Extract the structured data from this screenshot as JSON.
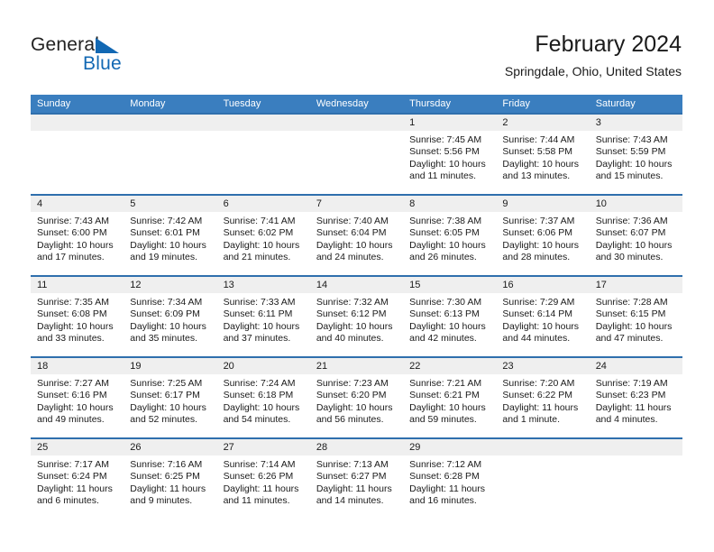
{
  "brand": {
    "name_part1": "General",
    "name_part2": "Blue",
    "flag_icon": "blue-triangle-flag-icon",
    "accent_color": "#1268b3"
  },
  "header": {
    "title": "February 2024",
    "subtitle": "Springdale, Ohio, United States"
  },
  "theme": {
    "header_blue": "#3a7ebf",
    "row_divider_blue": "#2f6fad",
    "day_band_gray": "#efefef"
  },
  "weekdays": [
    "Sunday",
    "Monday",
    "Tuesday",
    "Wednesday",
    "Thursday",
    "Friday",
    "Saturday"
  ],
  "weeks": [
    [
      {
        "day": "",
        "sunrise": "",
        "sunset": "",
        "daylight1": "",
        "daylight2": ""
      },
      {
        "day": "",
        "sunrise": "",
        "sunset": "",
        "daylight1": "",
        "daylight2": ""
      },
      {
        "day": "",
        "sunrise": "",
        "sunset": "",
        "daylight1": "",
        "daylight2": ""
      },
      {
        "day": "",
        "sunrise": "",
        "sunset": "",
        "daylight1": "",
        "daylight2": ""
      },
      {
        "day": "1",
        "sunrise": "Sunrise: 7:45 AM",
        "sunset": "Sunset: 5:56 PM",
        "daylight1": "Daylight: 10 hours",
        "daylight2": "and 11 minutes."
      },
      {
        "day": "2",
        "sunrise": "Sunrise: 7:44 AM",
        "sunset": "Sunset: 5:58 PM",
        "daylight1": "Daylight: 10 hours",
        "daylight2": "and 13 minutes."
      },
      {
        "day": "3",
        "sunrise": "Sunrise: 7:43 AM",
        "sunset": "Sunset: 5:59 PM",
        "daylight1": "Daylight: 10 hours",
        "daylight2": "and 15 minutes."
      }
    ],
    [
      {
        "day": "4",
        "sunrise": "Sunrise: 7:43 AM",
        "sunset": "Sunset: 6:00 PM",
        "daylight1": "Daylight: 10 hours",
        "daylight2": "and 17 minutes."
      },
      {
        "day": "5",
        "sunrise": "Sunrise: 7:42 AM",
        "sunset": "Sunset: 6:01 PM",
        "daylight1": "Daylight: 10 hours",
        "daylight2": "and 19 minutes."
      },
      {
        "day": "6",
        "sunrise": "Sunrise: 7:41 AM",
        "sunset": "Sunset: 6:02 PM",
        "daylight1": "Daylight: 10 hours",
        "daylight2": "and 21 minutes."
      },
      {
        "day": "7",
        "sunrise": "Sunrise: 7:40 AM",
        "sunset": "Sunset: 6:04 PM",
        "daylight1": "Daylight: 10 hours",
        "daylight2": "and 24 minutes."
      },
      {
        "day": "8",
        "sunrise": "Sunrise: 7:38 AM",
        "sunset": "Sunset: 6:05 PM",
        "daylight1": "Daylight: 10 hours",
        "daylight2": "and 26 minutes."
      },
      {
        "day": "9",
        "sunrise": "Sunrise: 7:37 AM",
        "sunset": "Sunset: 6:06 PM",
        "daylight1": "Daylight: 10 hours",
        "daylight2": "and 28 minutes."
      },
      {
        "day": "10",
        "sunrise": "Sunrise: 7:36 AM",
        "sunset": "Sunset: 6:07 PM",
        "daylight1": "Daylight: 10 hours",
        "daylight2": "and 30 minutes."
      }
    ],
    [
      {
        "day": "11",
        "sunrise": "Sunrise: 7:35 AM",
        "sunset": "Sunset: 6:08 PM",
        "daylight1": "Daylight: 10 hours",
        "daylight2": "and 33 minutes."
      },
      {
        "day": "12",
        "sunrise": "Sunrise: 7:34 AM",
        "sunset": "Sunset: 6:09 PM",
        "daylight1": "Daylight: 10 hours",
        "daylight2": "and 35 minutes."
      },
      {
        "day": "13",
        "sunrise": "Sunrise: 7:33 AM",
        "sunset": "Sunset: 6:11 PM",
        "daylight1": "Daylight: 10 hours",
        "daylight2": "and 37 minutes."
      },
      {
        "day": "14",
        "sunrise": "Sunrise: 7:32 AM",
        "sunset": "Sunset: 6:12 PM",
        "daylight1": "Daylight: 10 hours",
        "daylight2": "and 40 minutes."
      },
      {
        "day": "15",
        "sunrise": "Sunrise: 7:30 AM",
        "sunset": "Sunset: 6:13 PM",
        "daylight1": "Daylight: 10 hours",
        "daylight2": "and 42 minutes."
      },
      {
        "day": "16",
        "sunrise": "Sunrise: 7:29 AM",
        "sunset": "Sunset: 6:14 PM",
        "daylight1": "Daylight: 10 hours",
        "daylight2": "and 44 minutes."
      },
      {
        "day": "17",
        "sunrise": "Sunrise: 7:28 AM",
        "sunset": "Sunset: 6:15 PM",
        "daylight1": "Daylight: 10 hours",
        "daylight2": "and 47 minutes."
      }
    ],
    [
      {
        "day": "18",
        "sunrise": "Sunrise: 7:27 AM",
        "sunset": "Sunset: 6:16 PM",
        "daylight1": "Daylight: 10 hours",
        "daylight2": "and 49 minutes."
      },
      {
        "day": "19",
        "sunrise": "Sunrise: 7:25 AM",
        "sunset": "Sunset: 6:17 PM",
        "daylight1": "Daylight: 10 hours",
        "daylight2": "and 52 minutes."
      },
      {
        "day": "20",
        "sunrise": "Sunrise: 7:24 AM",
        "sunset": "Sunset: 6:18 PM",
        "daylight1": "Daylight: 10 hours",
        "daylight2": "and 54 minutes."
      },
      {
        "day": "21",
        "sunrise": "Sunrise: 7:23 AM",
        "sunset": "Sunset: 6:20 PM",
        "daylight1": "Daylight: 10 hours",
        "daylight2": "and 56 minutes."
      },
      {
        "day": "22",
        "sunrise": "Sunrise: 7:21 AM",
        "sunset": "Sunset: 6:21 PM",
        "daylight1": "Daylight: 10 hours",
        "daylight2": "and 59 minutes."
      },
      {
        "day": "23",
        "sunrise": "Sunrise: 7:20 AM",
        "sunset": "Sunset: 6:22 PM",
        "daylight1": "Daylight: 11 hours",
        "daylight2": "and 1 minute."
      },
      {
        "day": "24",
        "sunrise": "Sunrise: 7:19 AM",
        "sunset": "Sunset: 6:23 PM",
        "daylight1": "Daylight: 11 hours",
        "daylight2": "and 4 minutes."
      }
    ],
    [
      {
        "day": "25",
        "sunrise": "Sunrise: 7:17 AM",
        "sunset": "Sunset: 6:24 PM",
        "daylight1": "Daylight: 11 hours",
        "daylight2": "and 6 minutes."
      },
      {
        "day": "26",
        "sunrise": "Sunrise: 7:16 AM",
        "sunset": "Sunset: 6:25 PM",
        "daylight1": "Daylight: 11 hours",
        "daylight2": "and 9 minutes."
      },
      {
        "day": "27",
        "sunrise": "Sunrise: 7:14 AM",
        "sunset": "Sunset: 6:26 PM",
        "daylight1": "Daylight: 11 hours",
        "daylight2": "and 11 minutes."
      },
      {
        "day": "28",
        "sunrise": "Sunrise: 7:13 AM",
        "sunset": "Sunset: 6:27 PM",
        "daylight1": "Daylight: 11 hours",
        "daylight2": "and 14 minutes."
      },
      {
        "day": "29",
        "sunrise": "Sunrise: 7:12 AM",
        "sunset": "Sunset: 6:28 PM",
        "daylight1": "Daylight: 11 hours",
        "daylight2": "and 16 minutes."
      },
      {
        "day": "",
        "sunrise": "",
        "sunset": "",
        "daylight1": "",
        "daylight2": ""
      },
      {
        "day": "",
        "sunrise": "",
        "sunset": "",
        "daylight1": "",
        "daylight2": ""
      }
    ]
  ]
}
